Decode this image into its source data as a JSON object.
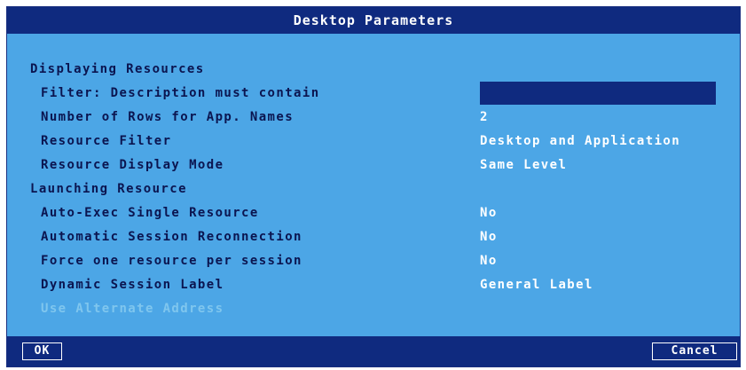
{
  "dialog": {
    "title": "Desktop Parameters",
    "ok_label": "OK",
    "cancel_label": "Cancel"
  },
  "sections": {
    "displaying": "Displaying Resources",
    "launching": "Launching Resource"
  },
  "fields": {
    "filter_description": {
      "label": "Filter: Description must contain",
      "value": ""
    },
    "rows_app_names": {
      "label": "Number of Rows for App. Names",
      "value": "2"
    },
    "resource_filter": {
      "label": "Resource Filter",
      "value": "Desktop and Application"
    },
    "resource_display_mode": {
      "label": "Resource Display Mode",
      "value": "Same Level"
    },
    "auto_exec": {
      "label": "Auto-Exec Single Resource",
      "value": "No"
    },
    "auto_reconnect": {
      "label": "Automatic Session Reconnection",
      "value": "No"
    },
    "force_one_resource": {
      "label": "Force one resource per session",
      "value": "No"
    },
    "dynamic_label": {
      "label": "Dynamic Session Label",
      "value": "General Label"
    },
    "alternate_address": {
      "label": "Use Alternate Address"
    }
  },
  "colors": {
    "dialog_background": "#4ca6e6",
    "bar_background": "#0f2a7f",
    "label_text": "#0b1550",
    "value_text": "#ffffff",
    "disabled_text": "#7fc6ee"
  }
}
